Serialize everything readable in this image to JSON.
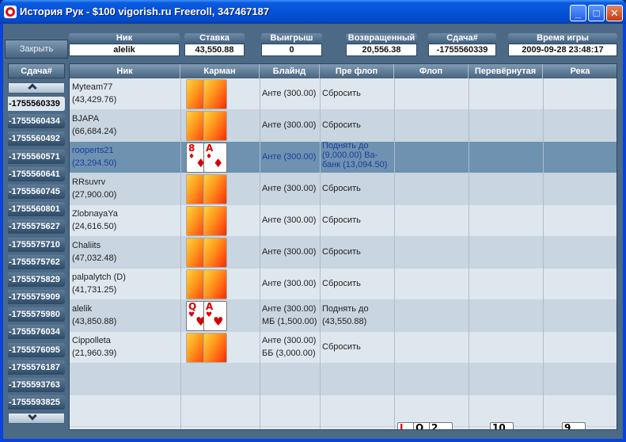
{
  "window": {
    "title": "История Рук - $100 vigorish.ru Freeroll, 347467187"
  },
  "close_label": "Закрыть",
  "header": [
    {
      "label": "Ник",
      "value": "alelik"
    },
    {
      "label": "Ставка",
      "value": "43,550.88"
    },
    {
      "label": "Выигрыш",
      "value": "0"
    },
    {
      "label": "Возвращенный",
      "value": "20,556.38"
    },
    {
      "label": "Сдача#",
      "value": "-1755560339"
    },
    {
      "label": "Время игры",
      "value": "2009-09-28 23:48:17"
    }
  ],
  "deals": {
    "label": "Сдача#",
    "items": [
      "-1755560339",
      "-1755560434",
      "-1755560492",
      "-1755560571",
      "-1755560641",
      "-1755560745",
      "-1755560801",
      "-1755575627",
      "-1755575710",
      "-1755575762",
      "-1755575829",
      "-1755575909",
      "-1755575980",
      "-1755576034",
      "-1755576095",
      "-1755576187",
      "-1755593763",
      "-1755593825"
    ]
  },
  "columns": [
    "Ник",
    "Карман",
    "Блайнд",
    "Пре флоп",
    "Флоп",
    "Перевёрнутая",
    "Река"
  ],
  "rows": [
    {
      "nick": "Myteam77",
      "stack": "(43,429.76)",
      "blind": "Анте (300.00)",
      "blind2": "",
      "preflop": "Сбросить"
    },
    {
      "nick": "BJAPA",
      "stack": "(66,684.24)",
      "blind": "Анте (300.00)",
      "blind2": "",
      "preflop": "Сбросить"
    },
    {
      "nick": "rooperts21",
      "stack": "(23,294.50)",
      "blind": "Анте (300.00)",
      "blind2": "",
      "preflop": "Поднять до (9,000.00) Ва-банк (13,094.50)",
      "cards": [
        {
          "rank": "8",
          "suit": "♦"
        },
        {
          "rank": "A",
          "suit": "♦"
        }
      ]
    },
    {
      "nick": "RRsuvrv",
      "stack": "(27,900.00)",
      "blind": "Анте (300.00)",
      "blind2": "",
      "preflop": "Сбросить"
    },
    {
      "nick": "ZlobnayaYa",
      "stack": "(24,616.50)",
      "blind": "Анте (300.00)",
      "blind2": "",
      "preflop": "Сбросить"
    },
    {
      "nick": "Chaliits",
      "stack": "(47,032.48)",
      "blind": "Анте (300.00)",
      "blind2": "",
      "preflop": "Сбросить"
    },
    {
      "nick": "palpalytch (D)",
      "stack": "(41,731.25)",
      "blind": "Анте (300.00)",
      "blind2": "",
      "preflop": "Сбросить"
    },
    {
      "nick": "alelik",
      "stack": "(43,850.88)",
      "blind": "Анте (300.00)",
      "blind2": "МБ (1,500.00)",
      "preflop": "Поднять до (43,550.88)",
      "cards": [
        {
          "rank": "Q",
          "suit": "♥"
        },
        {
          "rank": "A",
          "suit": "♥"
        }
      ]
    },
    {
      "nick": "Cippolleta",
      "stack": "(21,960.39)",
      "blind": "Анте (300.00)",
      "blind2": "ББ (3,000.00)",
      "preflop": "Сбросить"
    }
  ],
  "board": {
    "flop": [
      {
        "rank": "J",
        "suit": "♦"
      },
      {
        "rank": "Q",
        "suit": "♣"
      },
      {
        "rank": "2",
        "suit": "♠"
      }
    ],
    "turn": [
      {
        "rank": "10",
        "suit": "♣"
      }
    ],
    "river": [
      {
        "rank": "9",
        "suit": "♠"
      }
    ]
  },
  "colors": {
    "highlight_row": "#6e92b0",
    "title_bar": "#0552d6",
    "header_bg": "#47637f"
  }
}
